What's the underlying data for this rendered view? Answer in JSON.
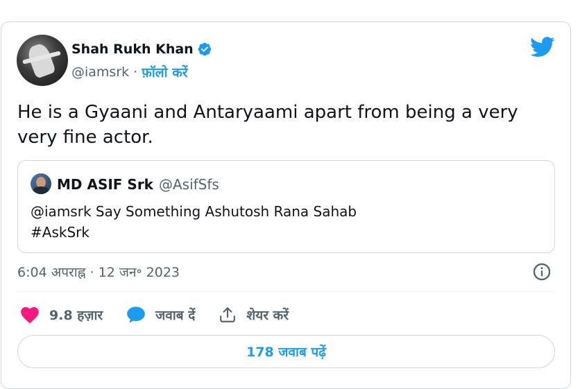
{
  "author": {
    "name": "Shah Rukh Khan",
    "handle": "@iamsrk",
    "separator": "·",
    "follow_label": "फ़ॉलो करें"
  },
  "tweet": {
    "text": "He is a Gyaani and Antaryaami apart from being a very very fine actor."
  },
  "quoted_tweet": {
    "name": "MD ASIF Srk",
    "handle": "@AsifSfs",
    "line1": "@iamsrk Say Something Ashutosh Rana Sahab",
    "line2": "#AskSrk"
  },
  "timestamp": "6:04 अपराह्न · 12 जन॰ 2023",
  "actions": {
    "likes": "9.8 हज़ार",
    "reply_label": "जवाब दें",
    "share_label": "शेयर करें"
  },
  "replies_button": "178 जवाब पढ़ें",
  "colors": {
    "accent": "#1d9bf0",
    "like": "#f91880",
    "text": "#0f1419",
    "muted": "#536471",
    "border": "#cfd9de"
  },
  "icons": [
    "verified-badge-icon",
    "twitter-bird-icon",
    "info-icon",
    "heart-icon",
    "reply-bubble-icon",
    "share-icon"
  ]
}
